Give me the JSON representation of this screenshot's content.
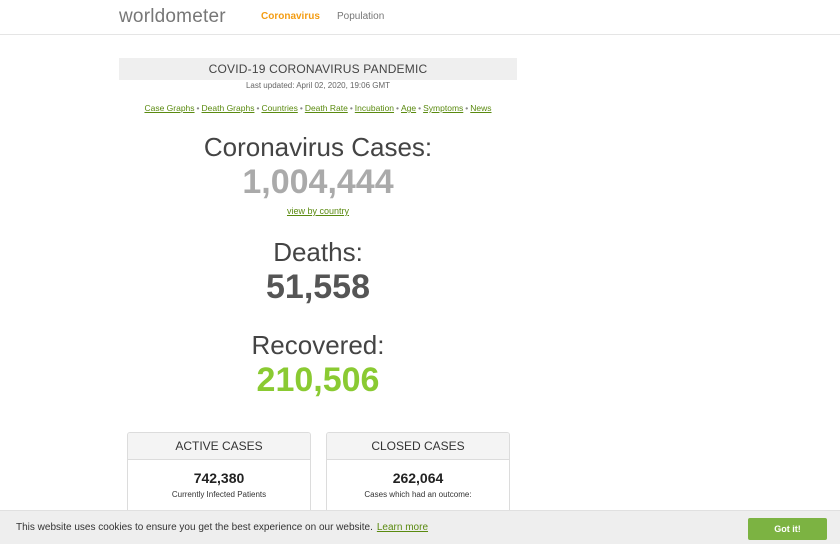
{
  "header": {
    "logo_pre": "worldo",
    "logo_post": "meter",
    "nav": [
      {
        "label": "Coronavirus",
        "active": true
      },
      {
        "label": "Population",
        "active": false
      }
    ]
  },
  "main": {
    "title": "COVID-19 CORONAVIRUS PANDEMIC",
    "last_updated": "Last updated: April 02, 2020, 19:06 GMT",
    "links": [
      "Case Graphs",
      "Death Graphs",
      "Countries",
      "Death Rate",
      "Incubation",
      "Age",
      "Symptoms",
      "News"
    ],
    "separator": "•",
    "cases": {
      "label": "Coronavirus Cases:",
      "value": "1,004,444",
      "link": "view by country"
    },
    "deaths": {
      "label": "Deaths:",
      "value": "51,558"
    },
    "recovered": {
      "label": "Recovered:",
      "value": "210,506"
    }
  },
  "panels": {
    "active": {
      "title": "ACTIVE CASES",
      "value": "742,380",
      "subtitle": "Currently Infected Patients"
    },
    "closed": {
      "title": "CLOSED CASES",
      "value": "262,064",
      "subtitle": "Cases which had an outcome:"
    }
  },
  "cookie": {
    "text": "This website uses cookies to ensure you get the best experience on our website.",
    "learn_more": "Learn more",
    "button": "Got it!"
  },
  "colors": {
    "accent_orange": "#f39c12",
    "link_green": "#5a8a0f",
    "recovered_green": "#8aca32",
    "button_green": "#7cb342"
  }
}
